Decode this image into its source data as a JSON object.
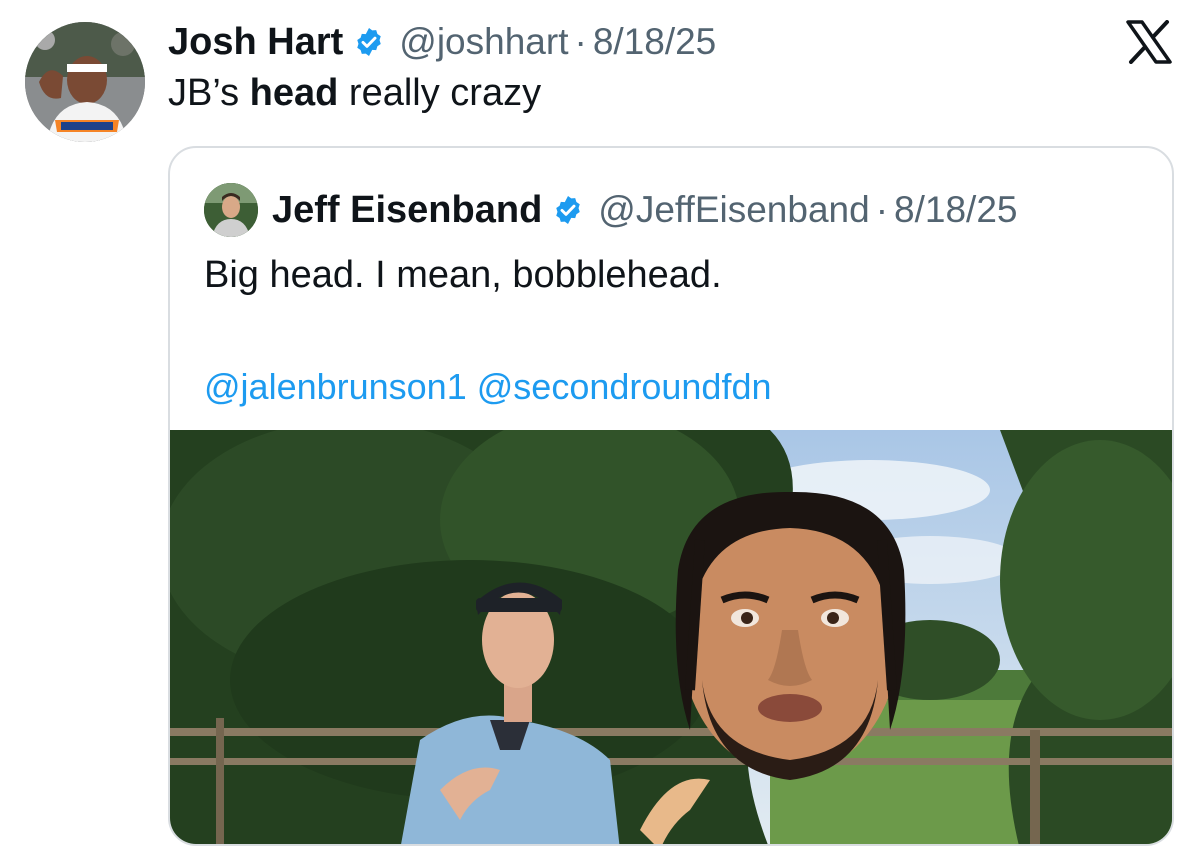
{
  "tweet": {
    "author_name": "Josh Hart",
    "handle": "@joshhart",
    "separator": "·",
    "date": "8/18/25",
    "text_before": "JB’s ",
    "text_bold": "head",
    "text_after": " really crazy",
    "verified_icon": "verified-badge-icon",
    "platform_icon": "x-logo-icon"
  },
  "quoted_tweet": {
    "author_name": "Jeff Eisenband",
    "handle": "@JeffEisenband",
    "separator": "·",
    "date": "8/18/25",
    "text": "Big head. I mean, bobblehead.",
    "mentions": [
      "@jalenbrunson1",
      "@secondroundfdn"
    ],
    "media_icon": "photo-icon"
  },
  "colors": {
    "text_primary": "#0f1419",
    "text_secondary": "#536471",
    "link": "#1d9bf0",
    "verified": "#1d9bf0",
    "card_border": "#d9dde1"
  }
}
